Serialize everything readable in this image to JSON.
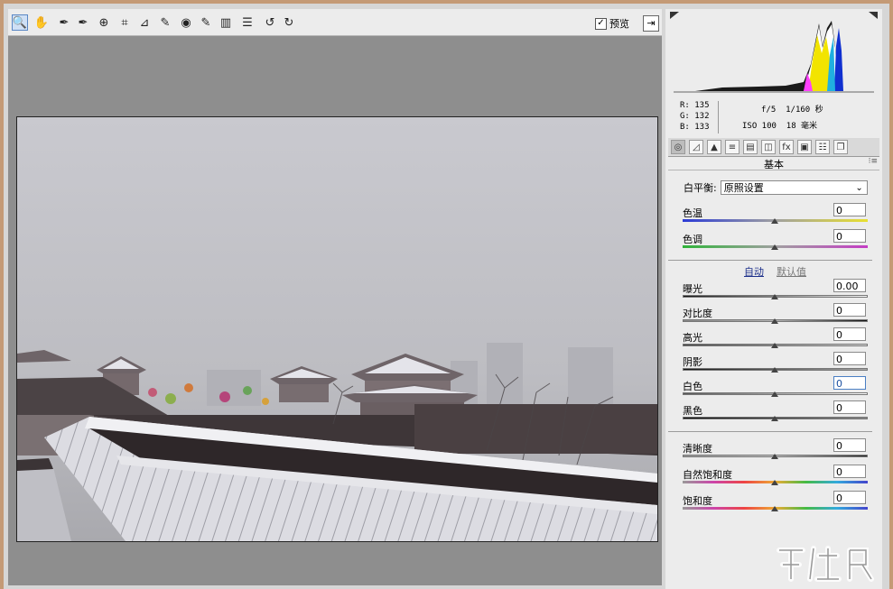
{
  "toolbar": {
    "tools": [
      {
        "name": "zoom-tool",
        "icon": "zoom-icon",
        "glyph": "🔍"
      },
      {
        "name": "hand-tool",
        "icon": "hand-icon",
        "glyph": "✋"
      },
      {
        "name": "white-balance-tool",
        "icon": "eyedropper-icon",
        "glyph": "✒"
      },
      {
        "name": "color-sampler-tool",
        "icon": "eyedropper-plus-icon",
        "glyph": "✒"
      },
      {
        "name": "targeted-adjustment-tool",
        "icon": "target-icon",
        "glyph": "⊕"
      },
      {
        "name": "crop-tool",
        "icon": "crop-icon",
        "glyph": "⌗"
      },
      {
        "name": "straighten-tool",
        "icon": "straighten-icon",
        "glyph": "⊿"
      },
      {
        "name": "spot-removal-tool",
        "icon": "spot-removal-icon",
        "glyph": "✎"
      },
      {
        "name": "red-eye-tool",
        "icon": "red-eye-icon",
        "glyph": "◉"
      },
      {
        "name": "adjustment-brush-tool",
        "icon": "brush-icon",
        "glyph": "✎"
      },
      {
        "name": "graduated-filter-tool",
        "icon": "graduated-filter-icon",
        "glyph": "▥"
      },
      {
        "name": "preferences-tool",
        "icon": "list-icon",
        "glyph": "☰"
      },
      {
        "name": "rotate-left-tool",
        "icon": "rotate-left-icon",
        "glyph": "↺"
      },
      {
        "name": "rotate-right-tool",
        "icon": "rotate-right-icon",
        "glyph": "↻"
      }
    ],
    "preview_label": "预览",
    "preview_check": "✓",
    "export_glyph": "⇥"
  },
  "info": {
    "r_label": "R:",
    "r_value": "135",
    "g_label": "G:",
    "g_value": "132",
    "b_label": "B:",
    "b_value": "133",
    "aperture": "f/5",
    "shutter": "1/160 秒",
    "iso": "ISO 100",
    "focal": "18 毫米"
  },
  "tabs": [
    {
      "name": "tab-basic",
      "icon": "aperture-icon",
      "glyph": "◎"
    },
    {
      "name": "tab-tone-curve",
      "icon": "curve-icon",
      "glyph": "◿"
    },
    {
      "name": "tab-detail",
      "icon": "detail-icon",
      "glyph": "▲"
    },
    {
      "name": "tab-hsl",
      "icon": "hsl-icon",
      "glyph": "≡"
    },
    {
      "name": "tab-split-toning",
      "icon": "split-toning-icon",
      "glyph": "▤"
    },
    {
      "name": "tab-lens",
      "icon": "lens-icon",
      "glyph": "◫"
    },
    {
      "name": "tab-effects",
      "icon": "fx-icon",
      "glyph": "fx"
    },
    {
      "name": "tab-camera-calibration",
      "icon": "camera-icon",
      "glyph": "▣"
    },
    {
      "name": "tab-presets",
      "icon": "presets-icon",
      "glyph": "☷"
    },
    {
      "name": "tab-snapshots",
      "icon": "snapshots-icon",
      "glyph": "❐"
    }
  ],
  "section": {
    "title": "基本",
    "menu_glyph": "⁝≡"
  },
  "white_balance": {
    "label": "白平衡:",
    "value": "原照设置",
    "chev": "⌄"
  },
  "auto_links": {
    "auto": "自动",
    "default": "默认值"
  },
  "sliders": [
    {
      "name": "temperature",
      "label": "色温",
      "value": "0"
    },
    {
      "name": "tint",
      "label": "色调",
      "value": "0"
    },
    {
      "name": "exposure",
      "label": "曝光",
      "value": "0.00"
    },
    {
      "name": "contrast",
      "label": "对比度",
      "value": "0"
    },
    {
      "name": "highlights",
      "label": "高光",
      "value": "0"
    },
    {
      "name": "shadows",
      "label": "阴影",
      "value": "0"
    },
    {
      "name": "whites",
      "label": "白色",
      "value": "0"
    },
    {
      "name": "blacks",
      "label": "黑色",
      "value": "0"
    },
    {
      "name": "clarity",
      "label": "清晰度",
      "value": "0"
    },
    {
      "name": "vibrance",
      "label": "自然饱和度",
      "value": "0"
    },
    {
      "name": "saturation",
      "label": "饱和度",
      "value": "0"
    }
  ],
  "colors": {
    "accent": "#1c2f8a",
    "panel": "#ececec",
    "canvas": "#8e8e8e"
  }
}
